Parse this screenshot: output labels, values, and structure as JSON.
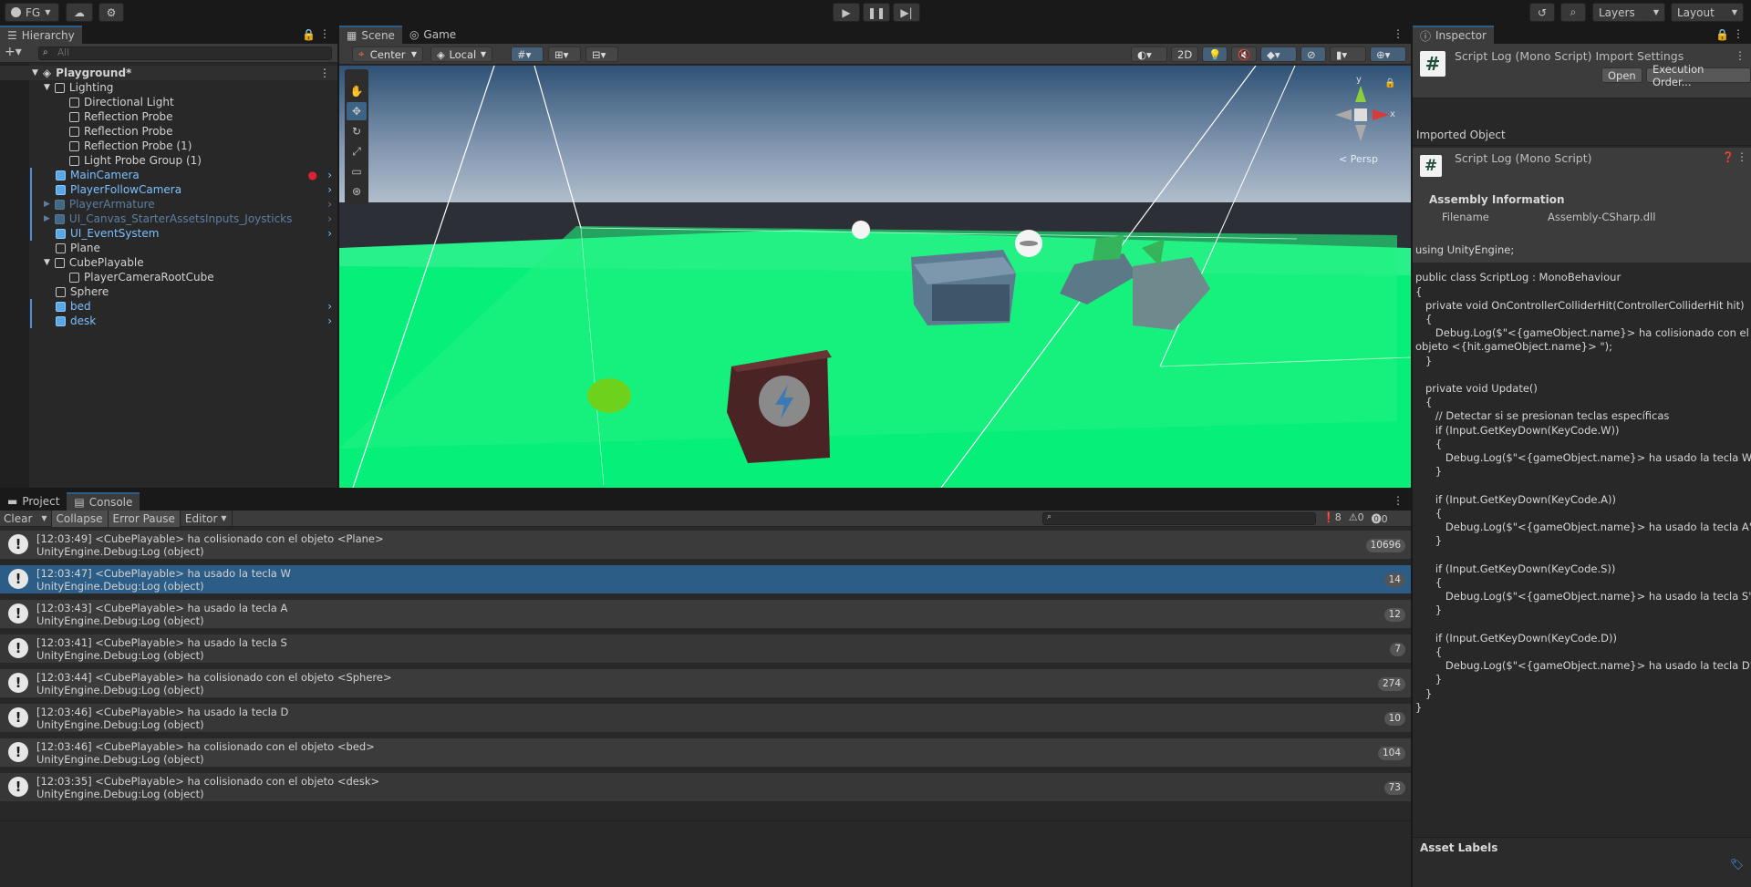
{
  "topbar": {
    "account": "FG",
    "layers": "Layers",
    "layout": "Layout"
  },
  "hierarchy": {
    "tab": "Hierarchy",
    "search_placeholder": "All",
    "scene": "Playground*",
    "items": [
      {
        "label": "Lighting"
      },
      {
        "label": "Directional Light"
      },
      {
        "label": "Reflection Probe"
      },
      {
        "label": "Reflection Probe"
      },
      {
        "label": "Reflection Probe (1)"
      },
      {
        "label": "Light Probe Group (1)"
      },
      {
        "label": "MainCamera"
      },
      {
        "label": "PlayerFollowCamera"
      },
      {
        "label": "PlayerArmature"
      },
      {
        "label": "UI_Canvas_StarterAssetsInputs_Joysticks"
      },
      {
        "label": "UI_EventSystem"
      },
      {
        "label": "Plane"
      },
      {
        "label": "CubePlayable"
      },
      {
        "label": "PlayerCameraRootCube"
      },
      {
        "label": "Sphere"
      },
      {
        "label": "bed"
      },
      {
        "label": "desk"
      }
    ]
  },
  "scene": {
    "tab_scene": "Scene",
    "tab_game": "Game",
    "pivot": "Center",
    "space": "Local",
    "mode2d": "2D",
    "persp": "< Persp",
    "gizmo_y": "y",
    "gizmo_x": "x"
  },
  "console": {
    "tab_project": "Project",
    "tab_console": "Console",
    "clear": "Clear",
    "collapse": "Collapse",
    "error_pause": "Error Pause",
    "editor": "Editor",
    "count_log": "8",
    "count_warn": "0",
    "count_err": "0",
    "rows": [
      {
        "line1": "[12:03:49] <CubePlayable> ha colisionado con el objeto <Plane>",
        "line2": "UnityEngine.Debug:Log (object)",
        "count": "10696"
      },
      {
        "line1": "[12:03:47] <CubePlayable> ha usado la tecla W",
        "line2": "UnityEngine.Debug:Log (object)",
        "count": "14"
      },
      {
        "line1": "[12:03:43] <CubePlayable> ha usado la tecla A",
        "line2": "UnityEngine.Debug:Log (object)",
        "count": "12"
      },
      {
        "line1": "[12:03:41] <CubePlayable> ha usado la tecla S",
        "line2": "UnityEngine.Debug:Log (object)",
        "count": "7"
      },
      {
        "line1": "[12:03:44] <CubePlayable> ha colisionado con el objeto <Sphere>",
        "line2": "UnityEngine.Debug:Log (object)",
        "count": "274"
      },
      {
        "line1": "[12:03:46] <CubePlayable> ha usado la tecla D",
        "line2": "UnityEngine.Debug:Log (object)",
        "count": "10"
      },
      {
        "line1": "[12:03:46] <CubePlayable> ha colisionado con el objeto <bed>",
        "line2": "UnityEngine.Debug:Log (object)",
        "count": "104"
      },
      {
        "line1": "[12:03:35] <CubePlayable> ha colisionado con el objeto <desk>",
        "line2": "UnityEngine.Debug:Log (object)",
        "count": "73"
      }
    ]
  },
  "inspector": {
    "tab": "Inspector",
    "title": "Script Log (Mono Script) Import Settings",
    "open": "Open",
    "execution_order": "Execution Order...",
    "imported_object": "Imported Object",
    "object_title": "Script Log (Mono Script)",
    "assembly_info": "Assembly Information",
    "filename_label": "Filename",
    "filename_value": "Assembly-CSharp.dll",
    "code": "using UnityEngine;\n\npublic class ScriptLog : MonoBehaviour\n{\n   private void OnControllerColliderHit(ControllerColliderHit hit)\n   {\n      Debug.Log($\"<{gameObject.name}> ha colisionado con el\nobjeto <{hit.gameObject.name}> \");\n   }\n\n   private void Update()\n   {\n      // Detectar si se presionan teclas específicas\n      if (Input.GetKeyDown(KeyCode.W))\n      {\n         Debug.Log($\"<{gameObject.name}> ha usado la tecla W\");\n      }\n\n      if (Input.GetKeyDown(KeyCode.A))\n      {\n         Debug.Log($\"<{gameObject.name}> ha usado la tecla A\");\n      }\n\n      if (Input.GetKeyDown(KeyCode.S))\n      {\n         Debug.Log($\"<{gameObject.name}> ha usado la tecla S\");\n      }\n\n      if (Input.GetKeyDown(KeyCode.D))\n      {\n         Debug.Log($\"<{gameObject.name}> ha usado la tecla D\");\n      }\n   }\n}",
    "asset_labels": "Asset Labels"
  },
  "colors": {
    "accent": "#2c5d87",
    "ground": "#1ff27f",
    "selected_row": "#2c5d87"
  }
}
